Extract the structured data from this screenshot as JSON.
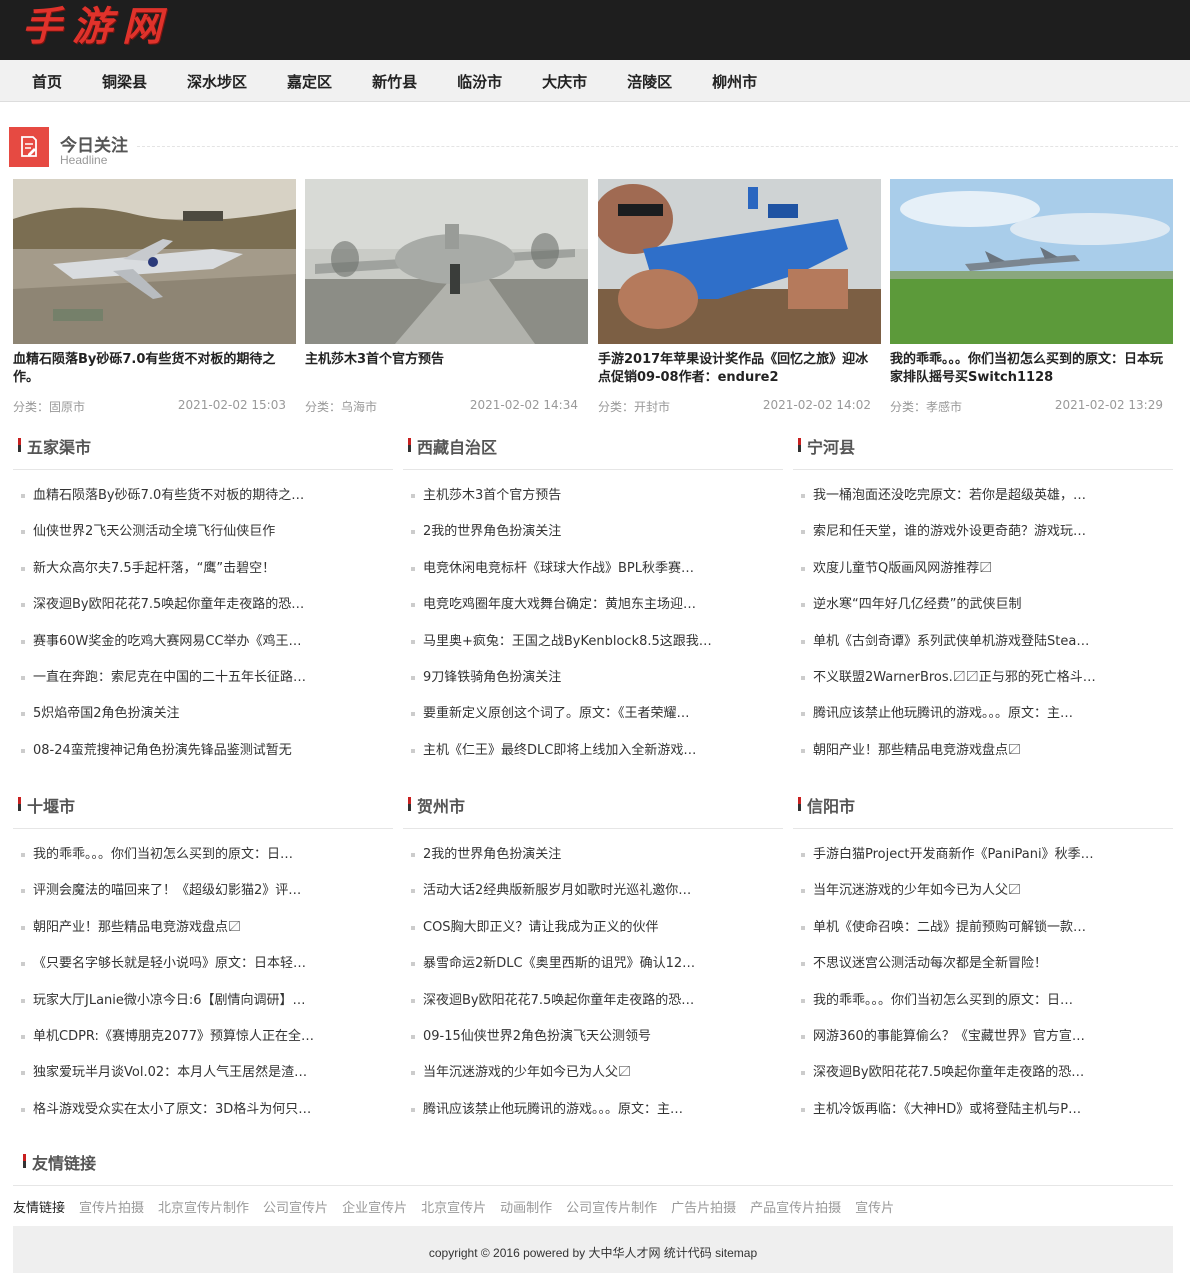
{
  "site": {
    "logo": "手游网"
  },
  "nav": [
    "首页",
    "铜梁县",
    "深水埗区",
    "嘉定区",
    "新竹县",
    "临汾市",
    "大庆市",
    "涪陵区",
    "柳州市"
  ],
  "headline": {
    "title": "今日关注",
    "subtitle": "Headline",
    "cards": [
      {
        "title": "血精石陨落By砂砾7.0有些货不对板的期待之作。",
        "category_label": "分类：",
        "category": "固原市",
        "time": "2021-02-02 15:03"
      },
      {
        "title": "主机莎木3首个官方预告",
        "category_label": "分类：",
        "category": "乌海市",
        "time": "2021-02-02 14:34"
      },
      {
        "title": "手游2017年苹果设计奖作品《回忆之旅》迎冰点促销09-08作者：endure2",
        "category_label": "分类：",
        "category": "开封市",
        "time": "2021-02-02 14:02"
      },
      {
        "title": "我的乖乖。。。你们当初怎么买到的原文：日本玩家排队摇号买Switch1128",
        "category_label": "分类：",
        "category": "孝感市",
        "time": "2021-02-02 13:29"
      }
    ]
  },
  "blocks": [
    {
      "title": "五家渠市",
      "items": [
        "血精石陨落By砂砾7.0有些货不对板的期待之…",
        "仙侠世界2飞天公测活动全境飞行仙侠巨作",
        "新大众高尔夫7.5手起杆落，“鹰”击碧空！",
        "深夜迴By欧阳花花7.5唤起你童年走夜路的恐…",
        "赛事60W奖金的吃鸡大赛网易CC举办《鸡王…",
        "一直在奔跑：索尼克在中国的二十五年长征路…",
        "5炽焰帝国2角色扮演关注",
        "08-24蛮荒搜神记角色扮演先锋品鉴测试暂无"
      ]
    },
    {
      "title": "西藏自治区",
      "items": [
        "主机莎木3首个官方预告",
        "2我的世界角色扮演关注",
        "电竞休闲电竞标杆《球球大作战》BPL秋季赛…",
        "电竞吃鸡圈年度大戏舞台确定：黄旭东主场迎…",
        "马里奥+疯兔：王国之战ByKenblock8.5这跟我…",
        "9刀锋铁骑角色扮演关注",
        "要重新定义原创这个词了。原文：《王者荣耀…",
        "主机《仁王》最终DLC即将上线加入全新游戏…"
      ]
    },
    {
      "title": "宁河县",
      "items": [
        "我一桶泡面还没吃完原文：若你是超级英雄，…",
        "索尼和任天堂，谁的游戏外设更奇葩？游戏玩…",
        "欢度儿童节Q版画风网游推荐〼",
        "逆水寒“四年好几亿经费”的武侠巨制",
        "单机《古剑奇谭》系列武侠单机游戏登陆Stea…",
        "不义联盟2WarnerBros.〼〼正与邪的死亡格斗…",
        "腾讯应该禁止他玩腾讯的游戏。。。原文：主…",
        "朝阳产业！那些精品电竞游戏盘点〼"
      ]
    },
    {
      "title": "十堰市",
      "items": [
        "我的乖乖。。。你们当初怎么买到的原文：日…",
        "评测会魔法的喵回来了！《超级幻影猫2》评…",
        "朝阳产业！那些精品电竞游戏盘点〼",
        "《只要名字够长就是轻小说吗》原文：日本轻…",
        "玩家大厅JLanie微小凉今日:6【剧情向调研】…",
        "单机CDPR:《赛博朋克2077》预算惊人正在全…",
        "独家爱玩半月谈Vol.02：本月人气王居然是渣…",
        "格斗游戏受众实在太小了原文：3D格斗为何只…"
      ]
    },
    {
      "title": "贺州市",
      "items": [
        "2我的世界角色扮演关注",
        "活动大话2经典版新服岁月如歌时光巡礼邀你…",
        "COS胸大即正义？请让我成为正义的伙伴",
        "暴雪命运2新DLC《奥里西斯的诅咒》确认12…",
        "深夜迴By欧阳花花7.5唤起你童年走夜路的恐…",
        "09-15仙侠世界2角色扮演飞天公测领号",
        "当年沉迷游戏的少年如今已为人父〼",
        "腾讯应该禁止他玩腾讯的游戏。。。原文：主…"
      ]
    },
    {
      "title": "信阳市",
      "items": [
        "手游白猫Project开发商新作《PaniPani》秋季…",
        "当年沉迷游戏的少年如今已为人父〼",
        "单机《使命召唤：二战》提前预购可解锁一款…",
        "不思议迷宫公测活动每次都是全新冒险！",
        "我的乖乖。。。你们当初怎么买到的原文：日…",
        "网游360的事能算偷么？《宝藏世界》官方宣…",
        "深夜迴By欧阳花花7.5唤起你童年走夜路的恐…",
        "主机冷饭再临：《大神HD》或将登陆主机与P…"
      ]
    }
  ],
  "friend_links": {
    "title": "友情链接",
    "label": "友情链接",
    "links": [
      "宣传片拍摄",
      "北京宣传片制作",
      "公司宣传片",
      "企业宣传片",
      "北京宣传片",
      "动画制作",
      "公司宣传片制作",
      "广告片拍摄",
      "产品宣传片拍摄",
      "宣传片"
    ]
  },
  "footer": {
    "text": "copyright © 2016 powered by 大中华人才网 统计代码 sitemap"
  },
  "colors": {
    "header_bg": "#1e1e1e",
    "logo": "#e0322b",
    "accent": "#e64a42"
  }
}
